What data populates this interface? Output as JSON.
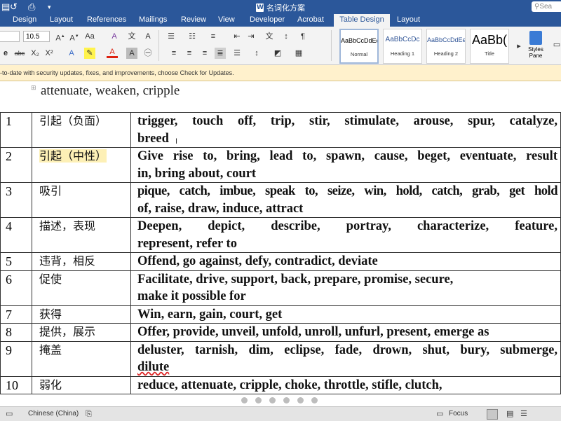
{
  "window": {
    "title": "名词化方案",
    "search_placeholder": "Sea"
  },
  "tabs": [
    {
      "label": "Design"
    },
    {
      "label": "Layout"
    },
    {
      "label": "References"
    },
    {
      "label": "Mailings"
    },
    {
      "label": "Review"
    },
    {
      "label": "View"
    },
    {
      "label": "Developer"
    },
    {
      "label": "Acrobat"
    },
    {
      "label": "Table Design"
    },
    {
      "label": "Layout"
    }
  ],
  "ribbon": {
    "font_size": "10.5",
    "styles": [
      {
        "preview": "AaBbCcDdEe",
        "name": "Normal"
      },
      {
        "preview": "AaBbCcDc",
        "name": "Heading 1"
      },
      {
        "preview": "AaBbCcDdEe",
        "name": "Heading 2"
      },
      {
        "preview": "AaBb(",
        "name": "Title"
      }
    ],
    "styles_pane": "Styles Pane"
  },
  "message": "-to-date with security updates, fixes, and improvements, choose Check for Updates.",
  "document": {
    "cut_line": "attenuate, weaken, cripple",
    "rows": [
      {
        "num": "1",
        "zh": "引起（负面）",
        "en": [
          "trigger, touch off, trip, stir, stimulate, arouse, spur, catalyze,",
          "breed"
        ]
      },
      {
        "num": "2",
        "zh": "引起（中性）",
        "en": [
          "Give rise to, bring, lead to, spawn, cause, beget, eventuate, result",
          "in, bring about, court"
        ]
      },
      {
        "num": "3",
        "zh": "吸引",
        "en": [
          "pique, catch, imbue, speak to, seize, win, hold, catch, grab, get hold",
          "of, raise, draw, induce, attract"
        ]
      },
      {
        "num": "4",
        "zh": "描述，表现",
        "en": [
          "Deepen, depict, describe, portray, characterize, feature,",
          "represent, refer to"
        ]
      },
      {
        "num": "5",
        "zh": "违背，相反",
        "en": [
          "Offend, go against, defy, contradict, deviate"
        ]
      },
      {
        "num": "6",
        "zh": "促使",
        "en": [
          "Facilitate, drive, support, back, prepare, promise, secure,",
          "make it possible for"
        ]
      },
      {
        "num": "7",
        "zh": "获得",
        "en": [
          "Win, earn, gain, court, get"
        ]
      },
      {
        "num": "8",
        "zh": "提供，展示",
        "en": [
          "Offer, provide, unveil, unfold, unroll, unfurl, present, emerge as"
        ]
      },
      {
        "num": "9",
        "zh": "掩盖",
        "en": [
          "deluster, tarnish, dim, eclipse, fade, drown, shut, bury, submerge,",
          "dilute"
        ]
      },
      {
        "num": "10",
        "zh": "弱化",
        "en": [
          "reduce, attenuate, cripple, choke, throttle, stifle, clutch,"
        ]
      }
    ]
  },
  "status": {
    "language": "Chinese (China)",
    "focus": "Focus"
  }
}
